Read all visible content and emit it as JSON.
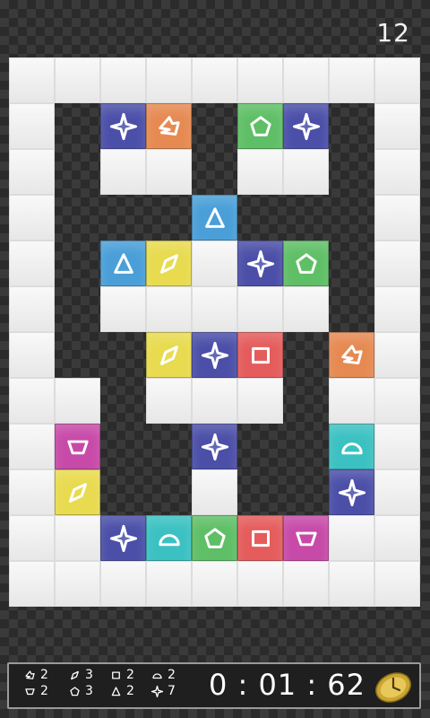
{
  "score": "12",
  "timer": "0 : 01 : 62",
  "colors": {
    "blue": "#5d6dc8",
    "orange": "#e68a52",
    "green": "#5fbf66",
    "lightblue": "#4a9fd8",
    "yellow": "#e8db4f",
    "red": "#e55c5c",
    "magenta": "#c74aa8",
    "teal": "#3cc1c2",
    "star": "#4b4fa8"
  },
  "board": {
    "cols": 9,
    "rows": 12,
    "walls": [
      [
        0,
        0
      ],
      [
        1,
        0
      ],
      [
        2,
        0
      ],
      [
        3,
        0
      ],
      [
        4,
        0
      ],
      [
        5,
        0
      ],
      [
        6,
        0
      ],
      [
        7,
        0
      ],
      [
        8,
        0
      ],
      [
        0,
        1
      ],
      [
        8,
        1
      ],
      [
        0,
        2
      ],
      [
        2,
        2
      ],
      [
        3,
        2
      ],
      [
        5,
        2
      ],
      [
        6,
        2
      ],
      [
        8,
        2
      ],
      [
        0,
        3
      ],
      [
        8,
        3
      ],
      [
        0,
        4
      ],
      [
        4,
        4
      ],
      [
        8,
        4
      ],
      [
        0,
        5
      ],
      [
        2,
        5
      ],
      [
        3,
        5
      ],
      [
        4,
        5
      ],
      [
        5,
        5
      ],
      [
        6,
        5
      ],
      [
        8,
        5
      ],
      [
        0,
        6
      ],
      [
        8,
        6
      ],
      [
        0,
        7
      ],
      [
        1,
        7
      ],
      [
        3,
        7
      ],
      [
        4,
        7
      ],
      [
        5,
        7
      ],
      [
        7,
        7
      ],
      [
        8,
        7
      ],
      [
        0,
        8
      ],
      [
        8,
        8
      ],
      [
        0,
        9
      ],
      [
        4,
        9
      ],
      [
        8,
        9
      ],
      [
        0,
        10
      ],
      [
        1,
        10
      ],
      [
        7,
        10
      ],
      [
        8,
        10
      ],
      [
        0,
        11
      ],
      [
        1,
        11
      ],
      [
        2,
        11
      ],
      [
        3,
        11
      ],
      [
        4,
        11
      ],
      [
        5,
        11
      ],
      [
        6,
        11
      ],
      [
        7,
        11
      ],
      [
        8,
        11
      ]
    ],
    "tiles": [
      {
        "col": 2,
        "row": 1,
        "shape": "star",
        "color": "star"
      },
      {
        "col": 3,
        "row": 1,
        "shape": "crescent",
        "color": "orange"
      },
      {
        "col": 5,
        "row": 1,
        "shape": "pentagon",
        "color": "green"
      },
      {
        "col": 6,
        "row": 1,
        "shape": "star",
        "color": "star"
      },
      {
        "col": 4,
        "row": 3,
        "shape": "triangle",
        "color": "lightblue"
      },
      {
        "col": 2,
        "row": 4,
        "shape": "triangle",
        "color": "lightblue"
      },
      {
        "col": 3,
        "row": 4,
        "shape": "diamond",
        "color": "yellow"
      },
      {
        "col": 5,
        "row": 4,
        "shape": "star",
        "color": "star"
      },
      {
        "col": 6,
        "row": 4,
        "shape": "pentagon",
        "color": "green"
      },
      {
        "col": 3,
        "row": 6,
        "shape": "diamond",
        "color": "yellow"
      },
      {
        "col": 4,
        "row": 6,
        "shape": "star",
        "color": "star"
      },
      {
        "col": 5,
        "row": 6,
        "shape": "square",
        "color": "red"
      },
      {
        "col": 7,
        "row": 6,
        "shape": "crescent",
        "color": "orange"
      },
      {
        "col": 1,
        "row": 8,
        "shape": "trapezoid",
        "color": "magenta"
      },
      {
        "col": 4,
        "row": 8,
        "shape": "star",
        "color": "star"
      },
      {
        "col": 7,
        "row": 8,
        "shape": "dome",
        "color": "teal"
      },
      {
        "col": 1,
        "row": 9,
        "shape": "diamond",
        "color": "yellow"
      },
      {
        "col": 7,
        "row": 9,
        "shape": "star",
        "color": "star"
      },
      {
        "col": 2,
        "row": 10,
        "shape": "star",
        "color": "star"
      },
      {
        "col": 3,
        "row": 10,
        "shape": "dome",
        "color": "teal"
      },
      {
        "col": 4,
        "row": 10,
        "shape": "pentagon",
        "color": "green"
      },
      {
        "col": 5,
        "row": 10,
        "shape": "square",
        "color": "red"
      },
      {
        "col": 6,
        "row": 10,
        "shape": "trapezoid",
        "color": "magenta"
      }
    ]
  },
  "counts": [
    {
      "shape": "crescent",
      "value": "2"
    },
    {
      "shape": "trapezoid",
      "value": "2"
    },
    {
      "shape": "diamond",
      "value": "3"
    },
    {
      "shape": "pentagon",
      "value": "3"
    },
    {
      "shape": "square",
      "value": "2"
    },
    {
      "shape": "triangle",
      "value": "2"
    },
    {
      "shape": "dome",
      "value": "2"
    },
    {
      "shape": "star",
      "value": "7"
    }
  ]
}
